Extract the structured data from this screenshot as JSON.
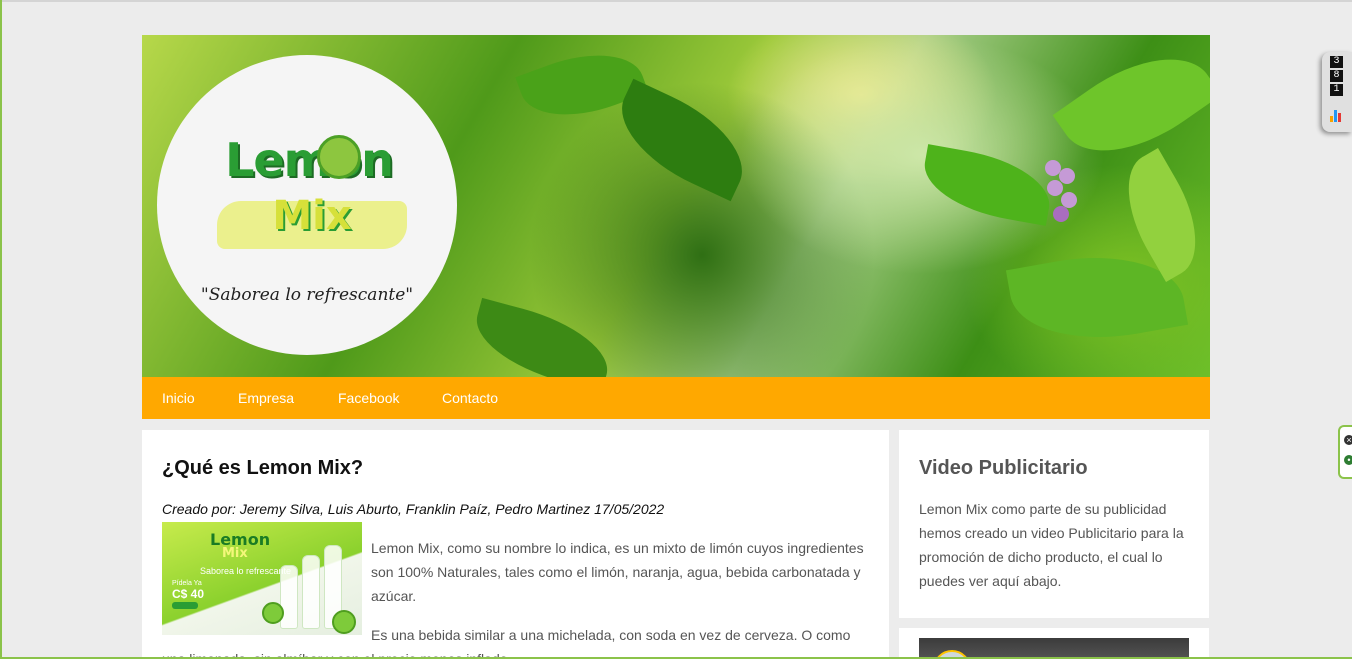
{
  "banner": {
    "logo": {
      "line1": "Lemon",
      "line2": "Mix",
      "slogan": "\"Saborea lo refrescante\""
    }
  },
  "nav": {
    "items": [
      {
        "label": "Inicio"
      },
      {
        "label": "Empresa"
      },
      {
        "label": "Facebook"
      },
      {
        "label": "Contacto"
      }
    ]
  },
  "main": {
    "title": "¿Qué es Lemon Mix?",
    "meta": "Creado por: Jeremy Silva, Luis Aburto, Franklin Paíz, Pedro Martinez 17/05/2022",
    "paragraph1": "Lemon Mix, como su nombre lo indica, es un mixto de limón cuyos ingredientes son 100% Naturales, tales como el limón, naranja, agua, bebida carbonatada y azúcar.",
    "paragraph2": "Es una bebida similar a una michelada, con soda en vez de cerveza. O como una limonada, sin almíbar y con el precio menos inflado.",
    "image": {
      "brand1": "Lemon",
      "brand2": "Mix",
      "slogan": "Saborea lo refrescante",
      "price_label": "Pídela Ya",
      "price": "C$ 40"
    }
  },
  "sidebar": {
    "title": "Video Publicitario",
    "text": "Lemon Mix como parte de su publicidad hemos creado un video Publicitario para la promoción de dicho producto, el cual lo puedes ver aquí abajo."
  },
  "counter": {
    "digits": [
      "3",
      "8",
      "1"
    ]
  },
  "colors": {
    "nav_bg": "#ffa800",
    "page_bg": "#ececec",
    "brand_green": "#2a9d34"
  }
}
